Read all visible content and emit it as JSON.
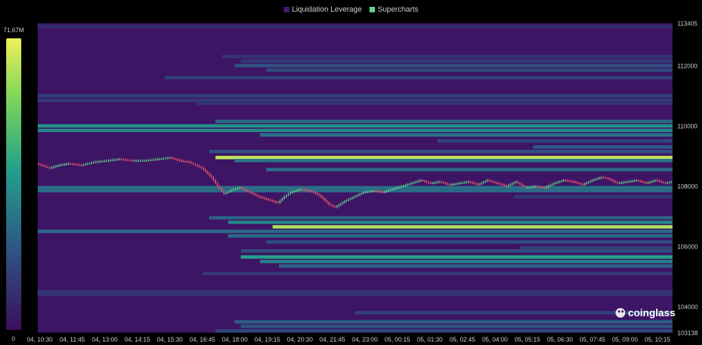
{
  "legend": {
    "items": [
      {
        "label": "Liquidation Leverage",
        "color": "#3f1a6e"
      },
      {
        "label": "Supercharts",
        "color": "#5fd08a"
      }
    ]
  },
  "watermark": "coinglass",
  "chart_data": {
    "type": "heatmap",
    "colorscale": {
      "max_label": "71.67M",
      "min_label": "0",
      "colors": [
        "#3b0f5e",
        "#2d5b86",
        "#23a08a",
        "#7fd65a",
        "#f1ef5a"
      ]
    },
    "y_range": [
      103138,
      113405
    ],
    "y_ticks": [
      113405,
      112000,
      110000,
      108000,
      106000,
      104000,
      103138
    ],
    "x_ticks": [
      "04, 10:30",
      "04, 11:45",
      "04, 13:00",
      "04, 14:15",
      "04, 15:30",
      "04, 16:45",
      "04, 18:00",
      "04, 19:15",
      "04, 20:30",
      "04, 21:45",
      "04, 23:00",
      "05, 00:15",
      "05, 01:30",
      "05, 02:45",
      "05, 04:00",
      "05, 05:15",
      "05, 06:30",
      "05, 07:45",
      "05, 09:00",
      "05, 10:15"
    ],
    "liquidation_bands": [
      {
        "price": 113300,
        "start": 0.0,
        "intensity": 0.1
      },
      {
        "price": 112300,
        "start": 0.29,
        "intensity": 0.12
      },
      {
        "price": 112150,
        "start": 0.32,
        "intensity": 0.14
      },
      {
        "price": 112000,
        "start": 0.31,
        "intensity": 0.22
      },
      {
        "price": 111850,
        "start": 0.36,
        "intensity": 0.2
      },
      {
        "price": 111600,
        "start": 0.2,
        "intensity": 0.16
      },
      {
        "price": 111000,
        "start": 0.0,
        "intensity": 0.16
      },
      {
        "price": 110850,
        "start": 0.0,
        "intensity": 0.14
      },
      {
        "price": 110750,
        "start": 0.25,
        "intensity": 0.12
      },
      {
        "price": 110150,
        "start": 0.28,
        "intensity": 0.3
      },
      {
        "price": 110000,
        "start": 0.0,
        "intensity": 0.45
      },
      {
        "price": 109850,
        "start": 0.0,
        "intensity": 0.4
      },
      {
        "price": 109700,
        "start": 0.35,
        "intensity": 0.34
      },
      {
        "price": 109500,
        "start": 0.63,
        "intensity": 0.18
      },
      {
        "price": 109300,
        "start": 0.78,
        "intensity": 0.24
      },
      {
        "price": 109150,
        "start": 0.27,
        "intensity": 0.22
      },
      {
        "price": 108950,
        "start": 0.28,
        "intensity": 0.9
      },
      {
        "price": 108850,
        "start": 0.31,
        "intensity": 0.34
      },
      {
        "price": 108550,
        "start": 0.36,
        "intensity": 0.3
      },
      {
        "price": 107950,
        "start": 0.0,
        "intensity": 0.32
      },
      {
        "price": 107850,
        "start": 0.0,
        "intensity": 0.3
      },
      {
        "price": 107650,
        "start": 0.75,
        "intensity": 0.14
      },
      {
        "price": 106950,
        "start": 0.27,
        "intensity": 0.28
      },
      {
        "price": 106800,
        "start": 0.3,
        "intensity": 0.4
      },
      {
        "price": 106650,
        "start": 0.37,
        "intensity": 0.85
      },
      {
        "price": 106500,
        "start": 0.0,
        "intensity": 0.3
      },
      {
        "price": 106350,
        "start": 0.3,
        "intensity": 0.3
      },
      {
        "price": 106150,
        "start": 0.36,
        "intensity": 0.2
      },
      {
        "price": 105950,
        "start": 0.76,
        "intensity": 0.16
      },
      {
        "price": 105850,
        "start": 0.32,
        "intensity": 0.2
      },
      {
        "price": 105650,
        "start": 0.32,
        "intensity": 0.5
      },
      {
        "price": 105500,
        "start": 0.35,
        "intensity": 0.38
      },
      {
        "price": 105350,
        "start": 0.38,
        "intensity": 0.28
      },
      {
        "price": 105100,
        "start": 0.26,
        "intensity": 0.14
      },
      {
        "price": 104500,
        "start": 0.0,
        "intensity": 0.13
      },
      {
        "price": 104400,
        "start": 0.0,
        "intensity": 0.12
      },
      {
        "price": 103800,
        "start": 0.5,
        "intensity": 0.16
      },
      {
        "price": 103500,
        "start": 0.31,
        "intensity": 0.26
      },
      {
        "price": 103350,
        "start": 0.32,
        "intensity": 0.22
      },
      {
        "price": 103200,
        "start": 0.28,
        "intensity": 0.18
      }
    ],
    "price_series": {
      "x": [
        0.0,
        0.02,
        0.035,
        0.05,
        0.07,
        0.09,
        0.11,
        0.13,
        0.15,
        0.17,
        0.19,
        0.21,
        0.225,
        0.24,
        0.25,
        0.26,
        0.275,
        0.285,
        0.295,
        0.31,
        0.32,
        0.335,
        0.35,
        0.365,
        0.38,
        0.39,
        0.4,
        0.415,
        0.43,
        0.445,
        0.46,
        0.47,
        0.485,
        0.5,
        0.515,
        0.53,
        0.545,
        0.56,
        0.575,
        0.59,
        0.605,
        0.62,
        0.635,
        0.65,
        0.665,
        0.68,
        0.695,
        0.71,
        0.725,
        0.74,
        0.755,
        0.77,
        0.785,
        0.8,
        0.815,
        0.83,
        0.845,
        0.86,
        0.875,
        0.89,
        0.9,
        0.915,
        0.93,
        0.945,
        0.96,
        0.975,
        0.99,
        1.0
      ],
      "y": [
        108750,
        108600,
        108700,
        108750,
        108700,
        108800,
        108850,
        108900,
        108850,
        108850,
        108900,
        108950,
        108850,
        108800,
        108700,
        108600,
        108300,
        108000,
        107750,
        107900,
        107950,
        107800,
        107650,
        107550,
        107450,
        107650,
        107800,
        107900,
        107850,
        107700,
        107400,
        107300,
        107500,
        107650,
        107800,
        107850,
        107800,
        107900,
        108000,
        108100,
        108200,
        108100,
        108150,
        108050,
        108100,
        108150,
        108050,
        108200,
        108100,
        108000,
        108150,
        107950,
        108000,
        107950,
        108100,
        108200,
        108150,
        108050,
        108200,
        108300,
        108250,
        108100,
        108150,
        108200,
        108100,
        108200,
        108100,
        108150
      ]
    }
  }
}
